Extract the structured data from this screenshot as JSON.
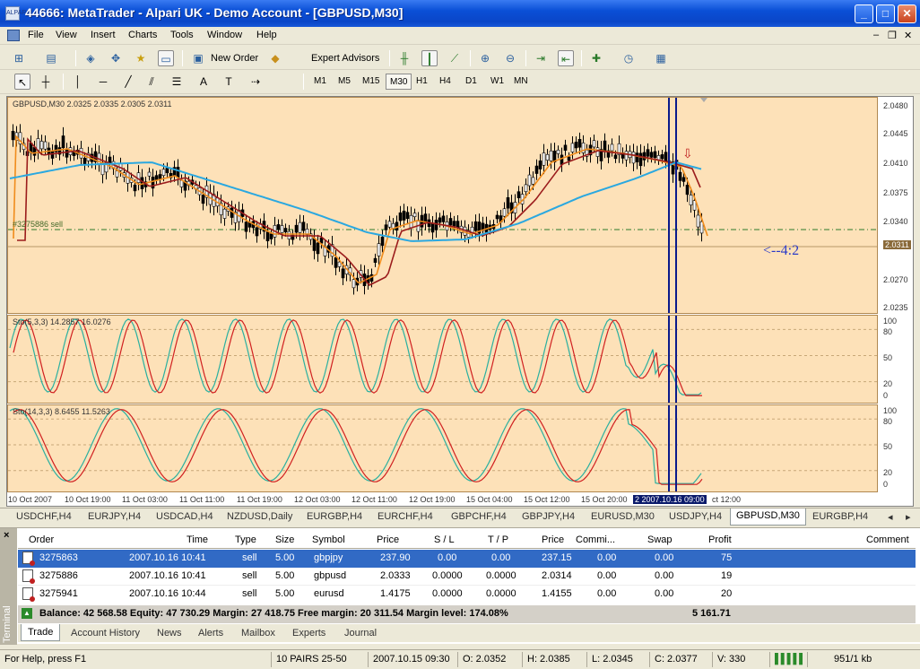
{
  "window": {
    "title": "44666: MetaTrader - Alpari UK - Demo Account - [GBPUSD,M30]",
    "app_icon_text": "ALPARI"
  },
  "menu": [
    "File",
    "View",
    "Insert",
    "Charts",
    "Tools",
    "Window",
    "Help"
  ],
  "toolbar": {
    "new_order": "New Order",
    "expert_advisors": "Expert Advisors",
    "timeframes": [
      "M1",
      "M5",
      "M15",
      "M30",
      "H1",
      "H4",
      "D1",
      "W1",
      "MN"
    ],
    "active_timeframe": "M30"
  },
  "chart": {
    "main_label": "GBPUSD,M30  2.0325 2.0335 2.0305 2.0311",
    "order_line_label": "#3275886 sell",
    "annotation": "<--4:2",
    "current_price": "2.0311",
    "price_ticks": [
      "2.0480",
      "2.0445",
      "2.0410",
      "2.0375",
      "2.0340",
      "2.0305",
      "2.0270",
      "2.0235"
    ],
    "stoch1_label": "Sto(5,3,3) 14.2857 16.0276",
    "stoch2_label": "Sto(14,3,3) 8.6455 11.5263",
    "osc_ticks": [
      "100",
      "80",
      "50",
      "20",
      "0"
    ],
    "x_labels": [
      "10 Oct 2007",
      "10 Oct 19:00",
      "11 Oct 03:00",
      "11 Oct 11:00",
      "11 Oct 19:00",
      "12 Oct 03:00",
      "12 Oct 11:00",
      "12 Oct 19:00",
      "15 Oct 04:00",
      "15 Oct 12:00",
      "15 Oct 20:00"
    ],
    "x_highlight": "2 2007.10.16 09:00",
    "x_last": "ct 12:00",
    "colors": {
      "background": "#fde1b8",
      "ma_fast": "#f08c1c",
      "ma_mid": "#9b1c1c",
      "ma_slow": "#2aa8e0",
      "stoch_main": "#2ab0a0",
      "stoch_signal": "#d02020",
      "vline": "#0a1a8b"
    }
  },
  "symbol_tabs": [
    "USDCHF,H4",
    "EURJPY,H4",
    "USDCAD,H4",
    "NZDUSD,Daily",
    "EURGBP,H4",
    "EURCHF,H4",
    "GBPCHF,H4",
    "GBPJPY,H4",
    "EURUSD,M30",
    "USDJPY,H4",
    "GBPUSD,M30",
    "EURGBP,H4"
  ],
  "terminal": {
    "side_label": "Terminal",
    "headers": [
      "Order",
      "Time",
      "Type",
      "Size",
      "Symbol",
      "Price",
      "S / L",
      "T / P",
      "Price",
      "Commi...",
      "Swap",
      "Profit",
      "Comment"
    ],
    "rows": [
      {
        "order": "3275863",
        "time": "2007.10.16 10:41",
        "type": "sell",
        "size": "5.00",
        "symbol": "gbpjpy",
        "price": "237.90",
        "sl": "0.00",
        "tp": "0.00",
        "cur_price": "237.15",
        "commission": "0.00",
        "swap": "0.00",
        "profit": "75"
      },
      {
        "order": "3275886",
        "time": "2007.10.16 10:41",
        "type": "sell",
        "size": "5.00",
        "symbol": "gbpusd",
        "price": "2.0333",
        "sl": "0.0000",
        "tp": "0.0000",
        "cur_price": "2.0314",
        "commission": "0.00",
        "swap": "0.00",
        "profit": "19"
      },
      {
        "order": "3275941",
        "time": "2007.10.16 10:44",
        "type": "sell",
        "size": "5.00",
        "symbol": "eurusd",
        "price": "1.4175",
        "sl": "0.0000",
        "tp": "0.0000",
        "cur_price": "1.4155",
        "commission": "0.00",
        "swap": "0.00",
        "profit": "20"
      }
    ],
    "balance_text": "Balance: 42 568.58  Equity: 47 730.29  Margin: 27 418.75  Free margin: 20 311.54  Margin level: 174.08%",
    "total_profit": "5 161.71",
    "tabs": [
      "Trade",
      "Account History",
      "News",
      "Alerts",
      "Mailbox",
      "Experts",
      "Journal"
    ]
  },
  "status": {
    "help": "For Help, press F1",
    "profile": "10 PAIRS 25-50",
    "datetime": "2007.10.15 09:30",
    "open": "O: 2.0352",
    "high": "H: 2.0385",
    "low": "L: 2.0345",
    "close": "C: 2.0377",
    "volume": "V: 330",
    "traffic": "951/1 kb"
  }
}
